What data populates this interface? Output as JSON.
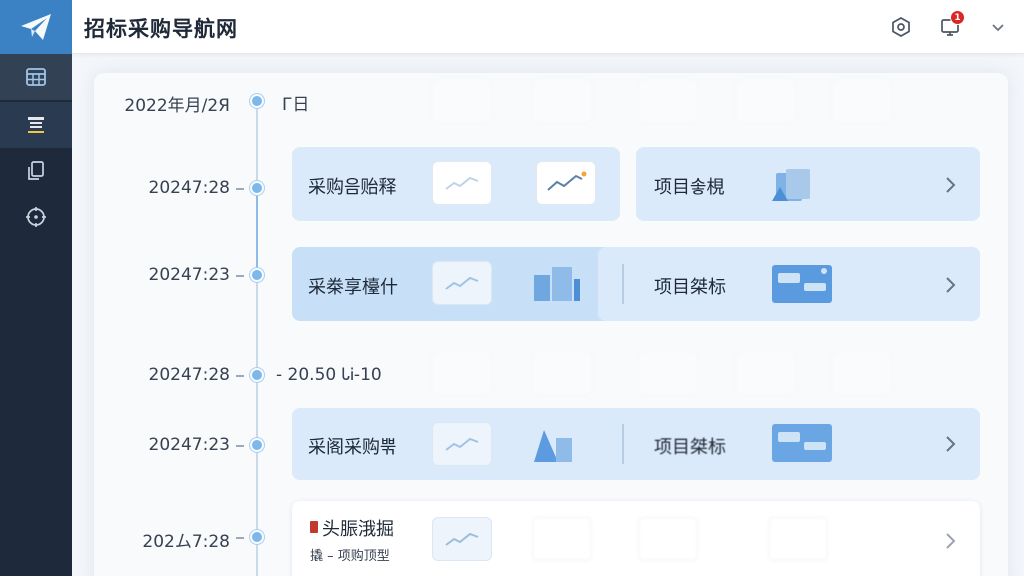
{
  "header": {
    "title": "招标采购导航网",
    "notification_count": "1"
  },
  "sidebar": {
    "items": [
      {
        "icon": "calendar-grid-icon"
      },
      {
        "icon": "document-list-icon"
      },
      {
        "icon": "copy-files-icon"
      },
      {
        "icon": "target-clock-icon"
      }
    ]
  },
  "timeline": {
    "rows": [
      {
        "date": "2022年月/2Я",
        "note": "Г日"
      },
      {
        "date": "20247:28",
        "card_title": "采购음贻释",
        "item_title": "项目솧梘"
      },
      {
        "date": "20247:23",
        "card_title": "采桊享檯什",
        "item_title": "项目桀标"
      },
      {
        "date": "20247:28",
        "note": "- 20.50 ᏓᎥ-10"
      },
      {
        "date": "20247:23",
        "card_title": "采阁采购뿎",
        "item_title": "项目桀标"
      },
      {
        "date": "202ム7:28",
        "card_title": "头脤涐掘",
        "card_subtitle": "撬 – 项购顶型"
      }
    ]
  },
  "colors": {
    "sidebar_bg": "#1e293b",
    "logo_bg": "#3b82c4",
    "accent": "#7cb8ea",
    "card_blue": "#dbeafa",
    "badge_red": "#dc2626"
  }
}
